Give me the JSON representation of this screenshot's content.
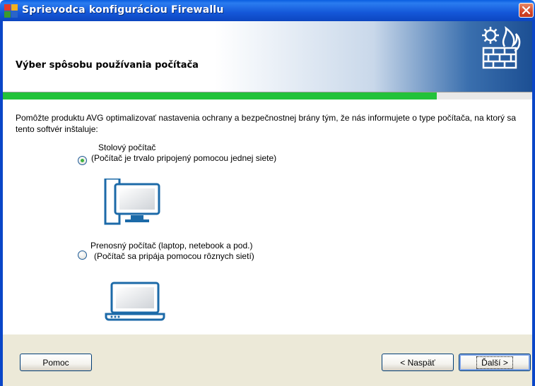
{
  "window": {
    "title": "Sprievodca konfiguráciou Firewallu",
    "app_icon": "avg-logo-icon",
    "close_icon": "close-icon"
  },
  "header": {
    "title": "Výber spôsobu používania počítača",
    "icon": "firewall-gear-flame-icon"
  },
  "progress": {
    "fraction": 0.82,
    "color": "#22c23a"
  },
  "content": {
    "intro": "Pomôžte produktu AVG optimalizovať nastavenia ochrany a bezpečnostnej brány tým, že nás informujete o type počítača, na ktorý sa tento softvér inštaluje:",
    "options": [
      {
        "label": "Stolový počítač",
        "description": "(Počítač je trvalo pripojený pomocou jednej siete)",
        "selected": true,
        "icon": "desktop-computer-icon"
      },
      {
        "label": "Prenosný počítač (laptop, netebook a pod.)",
        "description": "(Počítač sa pripája pomocou rôznych sietí)",
        "selected": false,
        "icon": "laptop-icon"
      }
    ]
  },
  "footer": {
    "help_label": "Pomoc",
    "back_label": "< Naspäť",
    "next_label": "Ďalší >"
  }
}
